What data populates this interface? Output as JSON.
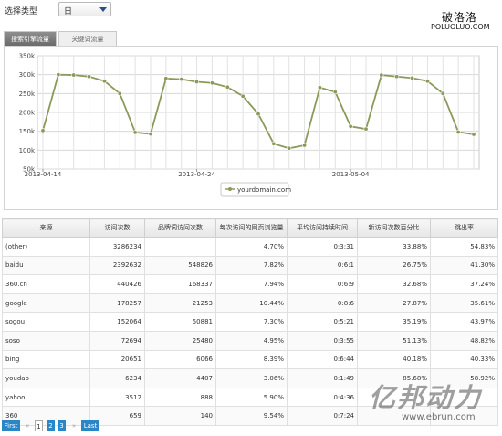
{
  "filter": {
    "label": "选择类型",
    "selected": "日"
  },
  "watermark_top": {
    "cn": "破洛洛",
    "en": "POLUOLUO.COM"
  },
  "tabs": [
    {
      "label": "搜索引擎流量",
      "active": true
    },
    {
      "label": "关键词流量",
      "active": false
    }
  ],
  "chart_data": {
    "type": "line",
    "y_ticks": [
      "350k",
      "300k",
      "250k",
      "200k",
      "150k",
      "100k",
      "50k"
    ],
    "ylim": [
      50000,
      350000
    ],
    "x_tick_labels": [
      "2013-04-14",
      "2013-04-24",
      "2013-05-04"
    ],
    "legend": "yourdomain.com",
    "legend_position": "bottom-center",
    "grid": true,
    "color": "#8a9a5b",
    "series": [
      {
        "name": "yourdomain.com",
        "x": [
          "2013-04-14",
          "2013-04-15",
          "2013-04-16",
          "2013-04-17",
          "2013-04-18",
          "2013-04-19",
          "2013-04-20",
          "2013-04-21",
          "2013-04-22",
          "2013-04-23",
          "2013-04-24",
          "2013-04-25",
          "2013-04-26",
          "2013-04-27",
          "2013-04-28",
          "2013-04-29",
          "2013-04-30",
          "2013-05-01",
          "2013-05-02",
          "2013-05-03",
          "2013-05-04",
          "2013-05-05",
          "2013-05-06",
          "2013-05-07",
          "2013-05-08",
          "2013-05-09",
          "2013-05-10",
          "2013-05-11",
          "2013-05-12"
        ],
        "values": [
          152000,
          300000,
          299000,
          295000,
          283000,
          250000,
          147000,
          143000,
          290000,
          288000,
          281000,
          278000,
          267000,
          243000,
          196000,
          117000,
          105000,
          113000,
          266000,
          254000,
          163000,
          156000,
          299000,
          295000,
          291000,
          283000,
          250000,
          148000,
          142000
        ]
      }
    ]
  },
  "table": {
    "headers": [
      "来源",
      "访问次数",
      "品牌词访问次数",
      "每次访问的网页浏览量",
      "平均访问持续时间",
      "新访问次数百分比",
      "跳出率"
    ],
    "rows": [
      [
        "(other)",
        "3286234",
        "",
        "4.70%",
        "0:3:31",
        "33.88%",
        "54.83%"
      ],
      [
        "baidu",
        "2392632",
        "548826",
        "7.82%",
        "0:6:1",
        "26.75%",
        "41.30%"
      ],
      [
        "360.cn",
        "440426",
        "168337",
        "7.94%",
        "0:6:9",
        "32.68%",
        "37.24%"
      ],
      [
        "google",
        "178257",
        "21253",
        "10.44%",
        "0:8:6",
        "27.87%",
        "35.61%"
      ],
      [
        "sogou",
        "152064",
        "50881",
        "7.30%",
        "0:5:21",
        "35.19%",
        "43.97%"
      ],
      [
        "soso",
        "72694",
        "25480",
        "4.95%",
        "0:3:55",
        "51.13%",
        "48.82%"
      ],
      [
        "bing",
        "20651",
        "6066",
        "8.39%",
        "0:6:44",
        "40.18%",
        "40.33%"
      ],
      [
        "youdao",
        "6234",
        "4407",
        "3.06%",
        "0:1:49",
        "85.68%",
        "58.92%"
      ],
      [
        "yahoo",
        "3512",
        "888",
        "5.90%",
        "0:4:36",
        "",
        ""
      ],
      [
        "360",
        "659",
        "140",
        "9.54%",
        "0:7:24",
        "",
        ""
      ]
    ]
  },
  "pager": {
    "first": "First",
    "prev": "«",
    "pages": [
      "1",
      "2",
      "3"
    ],
    "next": "»",
    "last": "Last"
  },
  "watermark_bottom": {
    "cn": "亿邦动力",
    "url": "www.ebrun.com"
  }
}
